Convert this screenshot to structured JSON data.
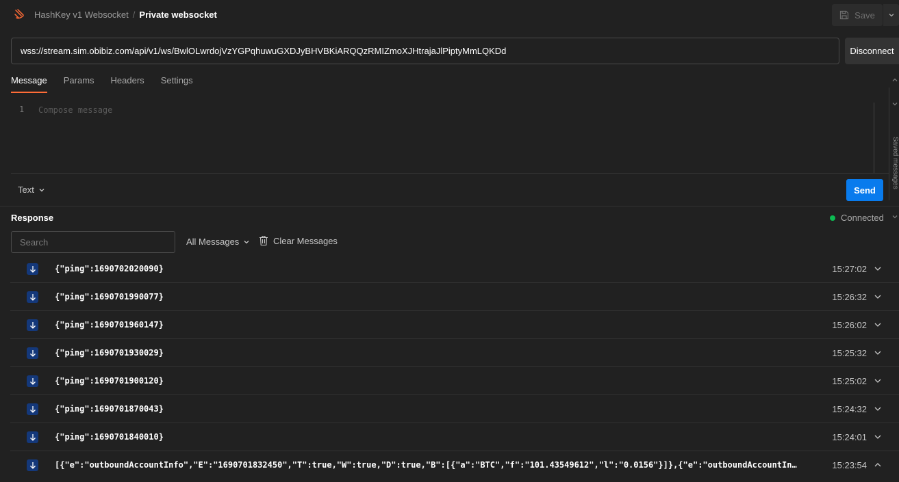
{
  "header": {
    "collection": "HashKey v1 Websocket",
    "separator": "/",
    "request_name": "Private websocket",
    "save_label": "Save"
  },
  "url": {
    "value": "wss://stream.sim.obibiz.com/api/v1/ws/BwlOLwrdojVzYGPqhuwuGXDJyBHVBKiARQQzRMIZmoXJHtrajaJlPiptyMmLQKDd",
    "disconnect_label": "Disconnect"
  },
  "tabs": [
    {
      "label": "Message",
      "active": true
    },
    {
      "label": "Params",
      "active": false
    },
    {
      "label": "Headers",
      "active": false
    },
    {
      "label": "Settings",
      "active": false
    }
  ],
  "editor": {
    "line_number": "1",
    "placeholder": "Compose message",
    "format": "Text",
    "send_label": "Send"
  },
  "side_panel": {
    "label": "Saved messages"
  },
  "response": {
    "title": "Response",
    "status": "Connected",
    "search_placeholder": "Search",
    "filter": "All Messages",
    "clear_label": "Clear Messages",
    "messages": [
      {
        "text": "{\"ping\":1690702020090}",
        "time": "15:27:02",
        "expanded": false
      },
      {
        "text": "{\"ping\":1690701990077}",
        "time": "15:26:32",
        "expanded": false
      },
      {
        "text": "{\"ping\":1690701960147}",
        "time": "15:26:02",
        "expanded": false
      },
      {
        "text": "{\"ping\":1690701930029}",
        "time": "15:25:32",
        "expanded": false
      },
      {
        "text": "{\"ping\":1690701900120}",
        "time": "15:25:02",
        "expanded": false
      },
      {
        "text": "{\"ping\":1690701870043}",
        "time": "15:24:32",
        "expanded": false
      },
      {
        "text": "{\"ping\":1690701840010}",
        "time": "15:24:01",
        "expanded": false
      },
      {
        "text": "[{\"e\":\"outboundAccountInfo\",\"E\":\"1690701832450\",\"T\":true,\"W\":true,\"D\":true,\"B\":[{\"a\":\"BTC\",\"f\":\"101.43549612\",\"l\":\"0.0156\"}]},{\"e\":\"outboundAccountInf…",
        "time": "15:23:54",
        "expanded": true
      }
    ]
  },
  "colors": {
    "accent": "#ff6c37",
    "send": "#097bed",
    "connected": "#0cbb52",
    "incoming_icon": "#14387a"
  }
}
